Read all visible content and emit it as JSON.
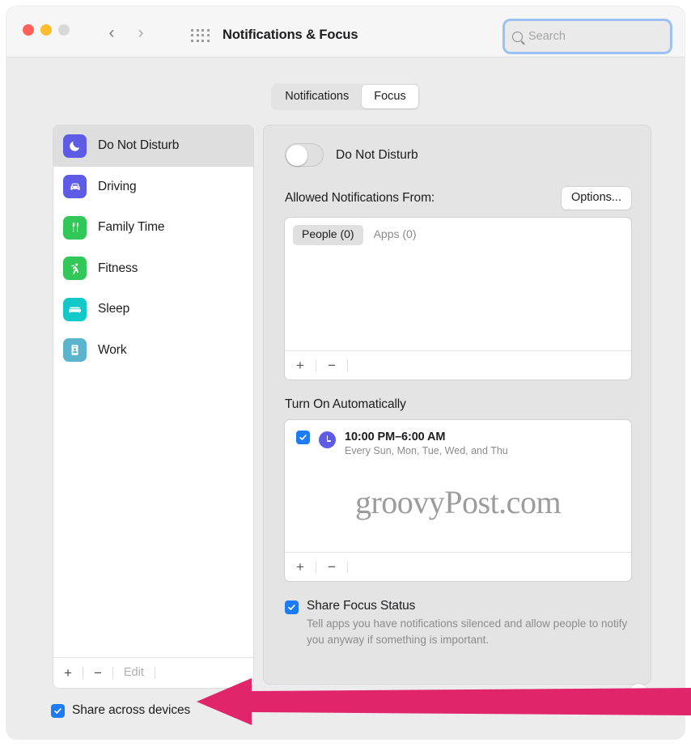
{
  "window": {
    "title": "Notifications & Focus",
    "traffic_lights": [
      "close",
      "minimize",
      "zoom"
    ],
    "nav_back": "‹",
    "nav_forward": "›",
    "grid_icon": "grid-icon"
  },
  "search": {
    "placeholder": "Search",
    "value": "",
    "icon": "search-icon"
  },
  "tabs": [
    {
      "label": "Notifications",
      "active": false
    },
    {
      "label": "Focus",
      "active": true
    }
  ],
  "sidebar": {
    "items": [
      {
        "label": "Do Not Disturb",
        "icon": "moon-icon",
        "color": "#5e5ce6",
        "selected": true
      },
      {
        "label": "Driving",
        "icon": "car-icon",
        "color": "#5e5ce6",
        "selected": false
      },
      {
        "label": "Family Time",
        "icon": "cutlery-icon",
        "color": "#32c759",
        "selected": false
      },
      {
        "label": "Fitness",
        "icon": "runner-icon",
        "color": "#32c759",
        "selected": false
      },
      {
        "label": "Sleep",
        "icon": "bed-icon",
        "color": "#12c8c8",
        "selected": false
      },
      {
        "label": "Work",
        "icon": "badge-icon",
        "color": "#5bb3cc",
        "selected": false
      }
    ],
    "footer": {
      "add_label": "+",
      "remove_label": "−",
      "edit_label": "Edit"
    }
  },
  "share_across_devices": {
    "label": "Share across devices",
    "checked": true
  },
  "detail": {
    "toggle": {
      "label": "Do Not Disturb",
      "on": false
    },
    "allowed": {
      "title": "Allowed Notifications From:",
      "options_button": "Options...",
      "tabs": [
        {
          "label": "People (0)",
          "active": true
        },
        {
          "label": "Apps (0)",
          "active": false
        }
      ],
      "entries": [],
      "add_label": "+",
      "remove_label": "−"
    },
    "turn_on_automatically": {
      "title": "Turn On Automatically",
      "schedules": [
        {
          "checked": true,
          "icon": "clock-icon",
          "time": "10:00 PM–6:00 AM",
          "days": "Every Sun, Mon, Tue, Wed, and Thu"
        }
      ],
      "add_label": "+",
      "remove_label": "−"
    },
    "share_focus_status": {
      "label": "Share Focus Status",
      "checked": true,
      "description": "Tell apps you have notifications silenced and allow people to notify you anyway if something is important."
    }
  },
  "watermark": "groovyPost.com",
  "help_button": "?",
  "annotation": {
    "type": "arrow",
    "color": "#e0256b",
    "points_to": "share-across-devices-checkbox"
  },
  "colors": {
    "accent_blue": "#1d7bf5",
    "focus_ring": "#9cc2f5",
    "annotation_pink": "#e0256b"
  }
}
